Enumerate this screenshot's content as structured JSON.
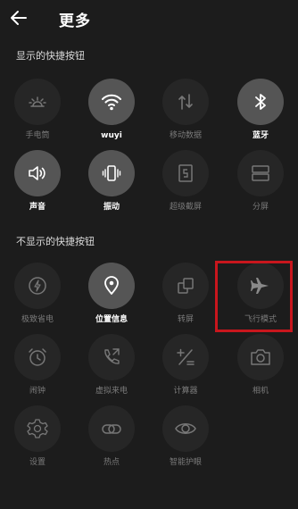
{
  "header": {
    "title": "更多"
  },
  "shown_section": {
    "label": "显示的快捷按钮",
    "items": [
      {
        "label": "手电筒",
        "icon": "flashlight-icon",
        "active": false
      },
      {
        "label": "wuyi",
        "icon": "wifi-icon",
        "active": true
      },
      {
        "label": "移动数据",
        "icon": "mobile-data-icon",
        "active": false
      },
      {
        "label": "蓝牙",
        "icon": "bluetooth-icon",
        "active": true
      },
      {
        "label": "声音",
        "icon": "sound-icon",
        "active": true
      },
      {
        "label": "振动",
        "icon": "vibrate-icon",
        "active": true
      },
      {
        "label": "超级截屏",
        "icon": "super-screenshot-icon",
        "active": false
      },
      {
        "label": "分屏",
        "icon": "split-screen-icon",
        "active": false
      }
    ]
  },
  "hidden_section": {
    "label": "不显示的快捷按钮",
    "items": [
      {
        "label": "极致省电",
        "icon": "power-saving-icon",
        "active": false
      },
      {
        "label": "位置信息",
        "icon": "location-icon",
        "active": true
      },
      {
        "label": "转屏",
        "icon": "rotate-screen-icon",
        "active": false
      },
      {
        "label": "飞行模式",
        "icon": "airplane-icon",
        "active": false
      },
      {
        "label": "闹钟",
        "icon": "alarm-icon",
        "active": false
      },
      {
        "label": "虚拟来电",
        "icon": "fake-call-icon",
        "active": false
      },
      {
        "label": "计算器",
        "icon": "calculator-icon",
        "active": false
      },
      {
        "label": "相机",
        "icon": "camera-icon",
        "active": false
      },
      {
        "label": "设置",
        "icon": "settings-icon",
        "active": false
      },
      {
        "label": "热点",
        "icon": "hotspot-icon",
        "active": false
      },
      {
        "label": "智能护眼",
        "icon": "eye-protection-icon",
        "active": false
      }
    ]
  },
  "colors": {
    "background": "#1c1c1c",
    "active_circle": "#555555",
    "inactive_circle": "#262626",
    "highlight": "#c8161d"
  }
}
